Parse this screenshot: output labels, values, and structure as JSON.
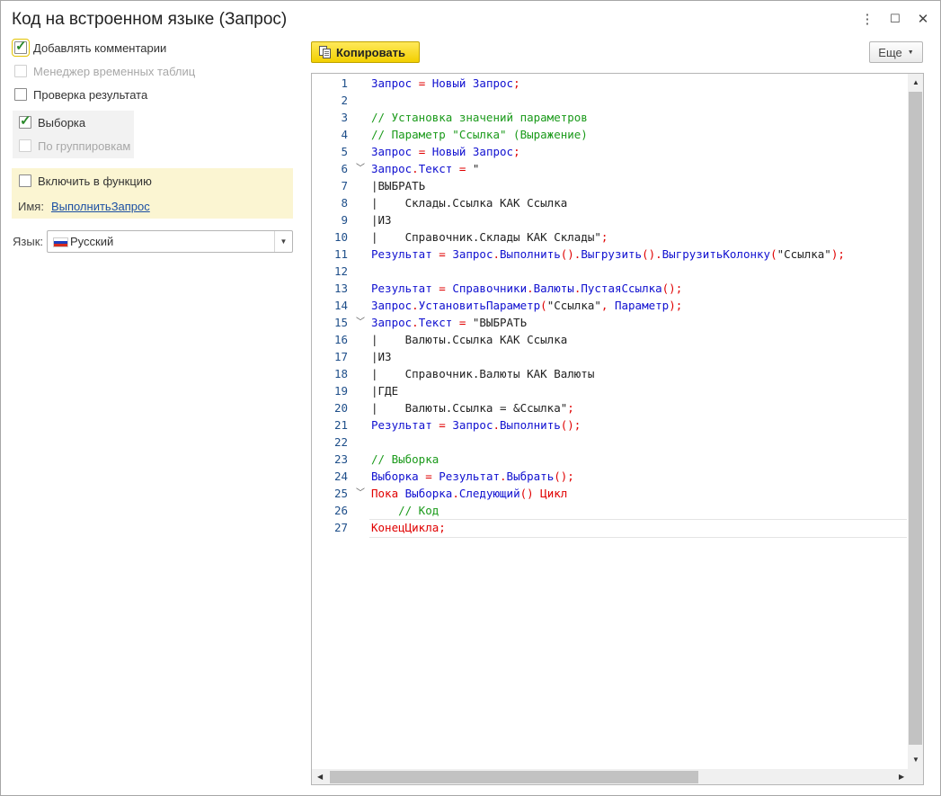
{
  "window": {
    "title": "Код на встроенном языке (Запрос)",
    "more_icon": "⋮",
    "maximize_icon": "☐",
    "close_icon": "✕"
  },
  "options": {
    "add_comments": {
      "label": "Добавлять комментарии",
      "checked": true
    },
    "temp_tables": {
      "label": "Менеджер временных таблиц",
      "checked": false,
      "disabled": true
    },
    "check_result": {
      "label": "Проверка результата",
      "checked": false
    },
    "selection": {
      "label": "Выборка",
      "checked": true
    },
    "by_groups": {
      "label": "По группировкам",
      "checked": false,
      "disabled": true
    },
    "wrap_function": {
      "label": "Включить в функцию",
      "checked": false
    },
    "name_label": "Имя:",
    "name_value": "ВыполнитьЗапрос",
    "lang_label": "Язык:",
    "lang_value": "Русский"
  },
  "toolbar": {
    "copy_label": "Копировать",
    "more_label": "Еще"
  },
  "colors": {
    "keyword": "#1010d0",
    "operator": "#e00000",
    "comment": "#1a9a1a",
    "accent": "#f2cf00"
  },
  "code": [
    {
      "n": "1",
      "fold": false,
      "tokens": [
        [
          "b",
          "Запрос "
        ],
        [
          "r",
          "= "
        ],
        [
          "b",
          "Новый "
        ],
        [
          "b",
          "Запрос"
        ],
        [
          "r",
          ";"
        ]
      ]
    },
    {
      "n": "2",
      "fold": false,
      "tokens": []
    },
    {
      "n": "3",
      "fold": false,
      "tokens": [
        [
          "g",
          "// Установка значений параметров"
        ]
      ]
    },
    {
      "n": "4",
      "fold": false,
      "tokens": [
        [
          "g",
          "// Параметр \"Ссылка\" (Выражение)"
        ]
      ]
    },
    {
      "n": "5",
      "fold": false,
      "tokens": [
        [
          "b",
          "Запрос "
        ],
        [
          "r",
          "= "
        ],
        [
          "b",
          "Новый "
        ],
        [
          "b",
          "Запрос"
        ],
        [
          "r",
          ";"
        ]
      ]
    },
    {
      "n": "6",
      "fold": true,
      "tokens": [
        [
          "b",
          "Запрос"
        ],
        [
          "r",
          "."
        ],
        [
          "b",
          "Текст "
        ],
        [
          "r",
          "= "
        ],
        [
          "k",
          "\""
        ]
      ]
    },
    {
      "n": "7",
      "fold": false,
      "tokens": [
        [
          "k",
          "|ВЫБРАТЬ"
        ]
      ]
    },
    {
      "n": "8",
      "fold": false,
      "tokens": [
        [
          "k",
          "|    Склады.Ссылка КАК Ссылка"
        ]
      ]
    },
    {
      "n": "9",
      "fold": false,
      "tokens": [
        [
          "k",
          "|ИЗ"
        ]
      ]
    },
    {
      "n": "10",
      "fold": false,
      "tokens": [
        [
          "k",
          "|    Справочник.Склады КАК Склады\""
        ],
        [
          "r",
          ";"
        ]
      ]
    },
    {
      "n": "11",
      "fold": false,
      "tokens": [
        [
          "b",
          "Результат "
        ],
        [
          "r",
          "= "
        ],
        [
          "b",
          "Запрос"
        ],
        [
          "r",
          "."
        ],
        [
          "b",
          "Выполнить"
        ],
        [
          "r",
          "()."
        ],
        [
          "b",
          "Выгрузить"
        ],
        [
          "r",
          "()."
        ],
        [
          "b",
          "ВыгрузитьКолонку"
        ],
        [
          "r",
          "("
        ],
        [
          "k",
          "\"Ссылка\""
        ],
        [
          "r",
          ");"
        ]
      ]
    },
    {
      "n": "12",
      "fold": false,
      "tokens": []
    },
    {
      "n": "13",
      "fold": false,
      "tokens": [
        [
          "b",
          "Результат "
        ],
        [
          "r",
          "= "
        ],
        [
          "b",
          "Справочники"
        ],
        [
          "r",
          "."
        ],
        [
          "b",
          "Валюты"
        ],
        [
          "r",
          "."
        ],
        [
          "b",
          "ПустаяСсылка"
        ],
        [
          "r",
          "();"
        ]
      ]
    },
    {
      "n": "14",
      "fold": false,
      "tokens": [
        [
          "b",
          "Запрос"
        ],
        [
          "r",
          "."
        ],
        [
          "b",
          "УстановитьПараметр"
        ],
        [
          "r",
          "("
        ],
        [
          "k",
          "\"Ссылка\""
        ],
        [
          "r",
          ", "
        ],
        [
          "b",
          "Параметр"
        ],
        [
          "r",
          ");"
        ]
      ]
    },
    {
      "n": "15",
      "fold": true,
      "tokens": [
        [
          "b",
          "Запрос"
        ],
        [
          "r",
          "."
        ],
        [
          "b",
          "Текст "
        ],
        [
          "r",
          "= "
        ],
        [
          "k",
          "\"ВЫБРАТЬ"
        ]
      ]
    },
    {
      "n": "16",
      "fold": false,
      "tokens": [
        [
          "k",
          "|    Валюты.Ссылка КАК Ссылка"
        ]
      ]
    },
    {
      "n": "17",
      "fold": false,
      "tokens": [
        [
          "k",
          "|ИЗ"
        ]
      ]
    },
    {
      "n": "18",
      "fold": false,
      "tokens": [
        [
          "k",
          "|    Справочник.Валюты КАК Валюты"
        ]
      ]
    },
    {
      "n": "19",
      "fold": false,
      "tokens": [
        [
          "k",
          "|ГДЕ"
        ]
      ]
    },
    {
      "n": "20",
      "fold": false,
      "tokens": [
        [
          "k",
          "|    Валюты.Ссылка = &Ссылка\""
        ],
        [
          "r",
          ";"
        ]
      ]
    },
    {
      "n": "21",
      "fold": false,
      "tokens": [
        [
          "b",
          "Результат "
        ],
        [
          "r",
          "= "
        ],
        [
          "b",
          "Запрос"
        ],
        [
          "r",
          "."
        ],
        [
          "b",
          "Выполнить"
        ],
        [
          "r",
          "();"
        ]
      ]
    },
    {
      "n": "22",
      "fold": false,
      "tokens": []
    },
    {
      "n": "23",
      "fold": false,
      "tokens": [
        [
          "g",
          "// Выборка"
        ]
      ]
    },
    {
      "n": "24",
      "fold": false,
      "tokens": [
        [
          "b",
          "Выборка "
        ],
        [
          "r",
          "= "
        ],
        [
          "b",
          "Результат"
        ],
        [
          "r",
          "."
        ],
        [
          "b",
          "Выбрать"
        ],
        [
          "r",
          "();"
        ]
      ]
    },
    {
      "n": "25",
      "fold": true,
      "tokens": [
        [
          "r",
          "Пока "
        ],
        [
          "b",
          "Выборка"
        ],
        [
          "r",
          "."
        ],
        [
          "b",
          "Следующий"
        ],
        [
          "r",
          "() Цикл"
        ]
      ]
    },
    {
      "n": "26",
      "fold": false,
      "tokens": [
        [
          "g",
          "    // Код"
        ]
      ]
    },
    {
      "n": "27",
      "fold": false,
      "tokens": [
        [
          "r",
          "КонецЦикла;"
        ]
      ]
    }
  ]
}
